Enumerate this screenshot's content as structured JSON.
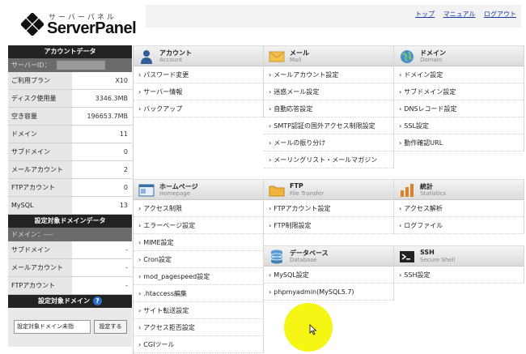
{
  "header": {
    "logo_kana": "サーバーパネル",
    "logo_text": "ServerPanel",
    "links": [
      "トップ",
      "マニュアル",
      "ログアウト"
    ]
  },
  "sidebar": {
    "account_title": "アカウントデータ",
    "server_id_label": "サーバーID：",
    "stats": [
      {
        "label": "ご利用プラン",
        "value": "X10"
      },
      {
        "label": "ディスク使用量",
        "value": "3346.3MB"
      },
      {
        "label": "空き容量",
        "value": "196653.7MB"
      },
      {
        "label": "ドメイン",
        "value": "11"
      },
      {
        "label": "サブドメイン",
        "value": "0"
      },
      {
        "label": "メールアカウント",
        "value": "2"
      },
      {
        "label": "FTPアカウント",
        "value": "0"
      },
      {
        "label": "MySQL",
        "value": "13"
      }
    ],
    "domain_data_title": "設定対象ドメインデータ",
    "domain_label": "ドメイン：----",
    "domain_stats": [
      {
        "label": "サブドメイン",
        "value": "-"
      },
      {
        "label": "メールアカウント",
        "value": "-"
      },
      {
        "label": "FTPアカウント",
        "value": "-"
      }
    ],
    "target_domain_title": "設定対象ドメイン",
    "select_value": "設定対象ドメイン未指",
    "set_button": "設定する"
  },
  "panels": {
    "account": {
      "title": "アカウント",
      "sub": "Account",
      "items": [
        "パスワード変更",
        "サーバー情報",
        "バックアップ"
      ]
    },
    "mail": {
      "title": "メール",
      "sub": "Mail",
      "items": [
        "メールアカウント設定",
        "迷惑メール設定",
        "自動応答設定",
        "SMTP認証の国外アクセス制限設定",
        "メールの振り分け",
        "メーリングリスト・メールマガジン"
      ]
    },
    "domain": {
      "title": "ドメイン",
      "sub": "Domain",
      "items": [
        "ドメイン設定",
        "サブドメイン設定",
        "DNSレコード設定",
        "SSL設定",
        "動作確認URL"
      ]
    },
    "homepage": {
      "title": "ホームページ",
      "sub": "Homepage",
      "items": [
        "アクセス制限",
        "エラーページ設定",
        "MIME設定",
        "Cron設定",
        "mod_pagespeed設定",
        ".htaccess編集",
        "サイト転送設定",
        "アクセス拒否設定",
        "CGIツール"
      ]
    },
    "ftp": {
      "title": "FTP",
      "sub": "File Transfer",
      "items": [
        "FTPアカウント設定",
        "FTP制限設定"
      ]
    },
    "stats": {
      "title": "統計",
      "sub": "Statistics",
      "items": [
        "アクセス解析",
        "ログファイル"
      ]
    },
    "database": {
      "title": "データベース",
      "sub": "Database",
      "items": [
        "MySQL設定",
        "phpmyadmin(MySQL5.7)"
      ]
    },
    "ssh": {
      "title": "SSH",
      "sub": "Secure Shell",
      "items": [
        "SSH設定"
      ]
    }
  },
  "colors": {
    "link": "#1a3aa8",
    "sidebar_header": "#222222",
    "cursor_highlight": "#f5f500"
  }
}
